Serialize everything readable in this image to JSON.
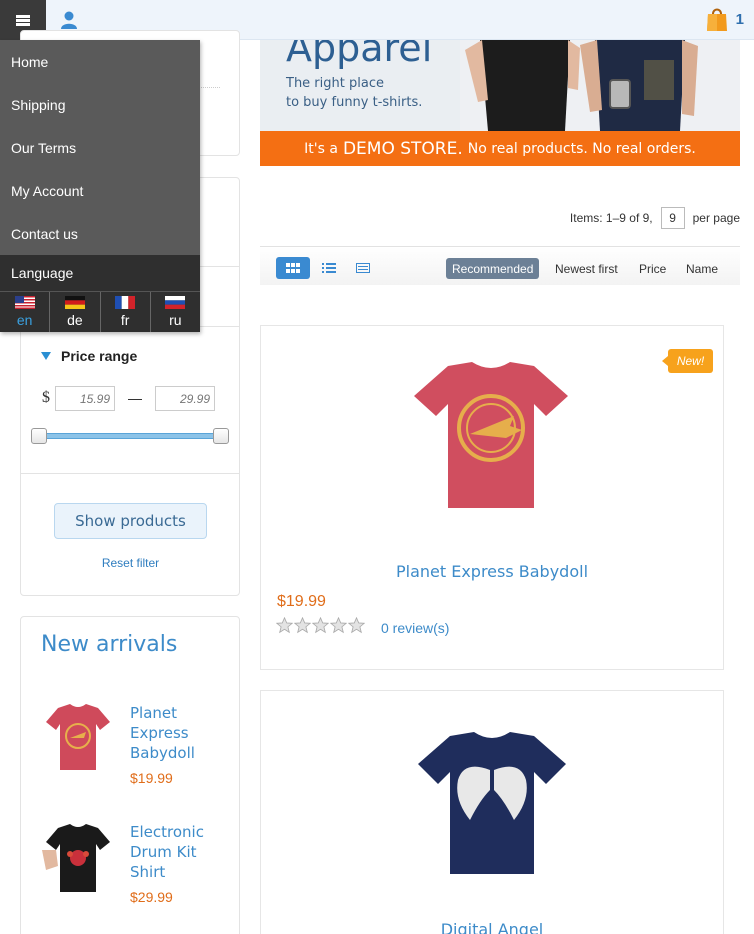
{
  "topbar": {
    "cart_count": "1"
  },
  "menu": {
    "items": [
      "Home",
      "Shipping",
      "Our Terms",
      "My Account",
      "Contact us"
    ],
    "language_label": "Language",
    "languages": [
      {
        "code": "en",
        "active": true
      },
      {
        "code": "de",
        "active": false
      },
      {
        "code": "fr",
        "active": false
      },
      {
        "code": "ru",
        "active": false
      }
    ]
  },
  "filter": {
    "price_range_title": "Price range",
    "currency": "$",
    "min_placeholder": "15.99",
    "max_placeholder": "29.99",
    "show_button": "Show products",
    "reset_link": "Reset filter"
  },
  "new_arrivals": {
    "title": "New arrivals",
    "items": [
      {
        "name": "Planet Express Babydoll",
        "price": "$19.99"
      },
      {
        "name": "Electronic Drum Kit Shirt",
        "price": "$29.99"
      }
    ]
  },
  "banner": {
    "title": "Apparel",
    "subtitle_line1": "The right place",
    "subtitle_line2": "to buy funny t-shirts.",
    "strip_pre": "It's a",
    "strip_bold": "DEMO STORE.",
    "strip_post": "No real products. No real orders."
  },
  "listing": {
    "items_text": "Items: 1–9 of 9,",
    "per_page_value": "9",
    "per_page_label": "per page",
    "sort_options": [
      "Recommended",
      "Newest first",
      "Price",
      "Name"
    ],
    "active_sort": "Recommended"
  },
  "products": [
    {
      "name": "Planet Express Babydoll",
      "price": "$19.99",
      "badge": "New!",
      "reviews": "0 review(s)",
      "rating": 0
    },
    {
      "name": "Digital Angel",
      "price": "",
      "badge": "",
      "reviews": "",
      "rating": 0
    }
  ],
  "colors": {
    "accent": "#3d8bc9",
    "price": "#e06d1a",
    "banner_strip": "#f46f13",
    "badge": "#f7a21c"
  }
}
